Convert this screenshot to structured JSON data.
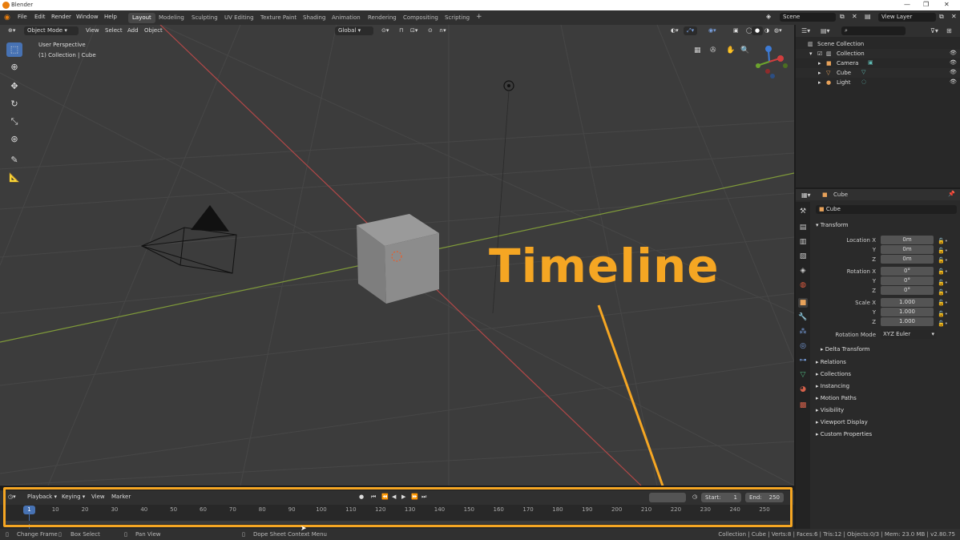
{
  "window": {
    "title": "Blender"
  },
  "menu": [
    "File",
    "Edit",
    "Render",
    "Window",
    "Help"
  ],
  "workspaces": [
    "Layout",
    "Modeling",
    "Sculpting",
    "UV Editing",
    "Texture Paint",
    "Shading",
    "Animation",
    "Rendering",
    "Compositing",
    "Scripting"
  ],
  "active_workspace": "Layout",
  "scene": {
    "label": "Scene",
    "view_layer": "View Layer"
  },
  "viewport": {
    "mode": "Object Mode",
    "menus": [
      "View",
      "Select",
      "Add",
      "Object"
    ],
    "orientation": "Global",
    "perspective_label": "User Perspective",
    "collection_label": "(1) Collection | Cube"
  },
  "outliner": {
    "rows": [
      {
        "label": "Scene Collection"
      },
      {
        "label": "Collection"
      },
      {
        "label": "Camera"
      },
      {
        "label": "Cube"
      },
      {
        "label": "Light"
      }
    ]
  },
  "properties": {
    "object_name": "Cube",
    "object_field": "Cube",
    "transform_title": "Transform",
    "location_x_label": "Location X",
    "location_x": "0m",
    "location_y_label": "Y",
    "location_y": "0m",
    "location_z_label": "Z",
    "location_z": "0m",
    "rotation_x_label": "Rotation X",
    "rotation_x": "0°",
    "rotation_y_label": "Y",
    "rotation_y": "0°",
    "rotation_z_label": "Z",
    "rotation_z": "0°",
    "scale_x_label": "Scale X",
    "scale_x": "1.000",
    "scale_y_label": "Y",
    "scale_y": "1.000",
    "scale_z_label": "Z",
    "scale_z": "1.000",
    "rotation_mode_label": "Rotation Mode",
    "rotation_mode": "XYZ Euler",
    "delta_transform": "Delta Transform",
    "panels": [
      "Relations",
      "Collections",
      "Instancing",
      "Motion Paths",
      "Visibility",
      "Viewport Display",
      "Custom Properties"
    ]
  },
  "timeline": {
    "menus": [
      "Playback",
      "Keying",
      "View",
      "Marker"
    ],
    "start_label": "Start:",
    "start": "1",
    "end_label": "End:",
    "end": "250",
    "current_frame": "1",
    "ticks": [
      "10",
      "20",
      "30",
      "40",
      "50",
      "60",
      "70",
      "80",
      "90",
      "100",
      "110",
      "120",
      "130",
      "140",
      "150",
      "160",
      "170",
      "180",
      "190",
      "200",
      "210",
      "220",
      "230",
      "240",
      "250"
    ]
  },
  "status": {
    "left1": "Change Frame",
    "left2": "Box Select",
    "left3": "Pan View",
    "left4": "Dope Sheet Context Menu",
    "right": "Collection | Cube | Verts:8 | Faces:6 | Tris:12 | Objects:0/3 | Mem: 23.0 MB | v2.80.75"
  },
  "annotation": {
    "text": "Timeline",
    "color": "#f5a623"
  },
  "colors": {
    "accent": "#4772b3",
    "highlight": "#f5a623",
    "x_axis": "#c84a4a",
    "y_axis": "#8aa83c"
  }
}
